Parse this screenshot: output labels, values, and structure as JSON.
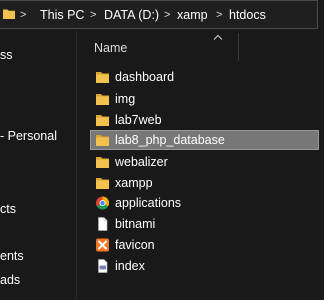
{
  "breadcrumb": {
    "separator": ">",
    "items": [
      "This PC",
      "DATA (D:)",
      "xamp",
      "htdocs"
    ]
  },
  "nav": {
    "items": [
      "ss",
      "- Personal",
      "cts",
      "ents",
      "ads"
    ]
  },
  "content": {
    "column_header": "Name",
    "files": [
      {
        "name": "dashboard",
        "icon": "folder-icon"
      },
      {
        "name": "img",
        "icon": "folder-icon"
      },
      {
        "name": "lab7web",
        "icon": "folder-icon"
      },
      {
        "name": "lab8_php_database",
        "icon": "folder-icon",
        "selected": true
      },
      {
        "name": "webalizer",
        "icon": "folder-icon"
      },
      {
        "name": "xampp",
        "icon": "folder-icon"
      },
      {
        "name": "applications",
        "icon": "chrome-icon"
      },
      {
        "name": "bitnami",
        "icon": "file-icon"
      },
      {
        "name": "favicon",
        "icon": "xampp-icon"
      },
      {
        "name": "index",
        "icon": "php-icon"
      }
    ]
  },
  "colors": {
    "folder": "#f2c14e",
    "selection": "#777777",
    "background": "#191919"
  }
}
